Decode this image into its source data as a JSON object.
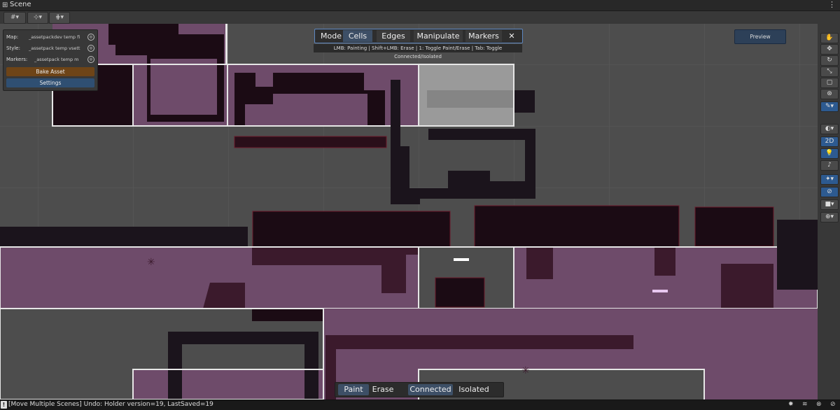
{
  "window": {
    "title": "Scene",
    "grid_icon": "grid-icon",
    "more_icon": "more-vertical-icon"
  },
  "toolbar": {
    "icons": [
      "gizmo-grid-icon",
      "snap-grid-icon",
      "increment-snap-icon"
    ]
  },
  "panel": {
    "map_label": "Map:",
    "map_value": "_assetpackdev temp fi",
    "style_label": "Style:",
    "style_value": "_assetpack temp vsett",
    "markers_label": "Markers:",
    "markers_value": "_assetpack temp m",
    "bake_button": "Bake Asset",
    "settings_button": "Settings",
    "bake_color": "#6e4417",
    "settings_color": "#2f4f72"
  },
  "modebar": {
    "mode_label": "Mode",
    "cells_tab": "Cells",
    "edges_tab": "Edges",
    "manipulate_tab": "Manipulate",
    "markers_tab": "Markers",
    "close_icon": "close-icon"
  },
  "hint": {
    "text": "LMB: Painting | Shift+LMB: Erase | 1: Toggle Paint/Erase | Tab: Toggle Connected/Isolated"
  },
  "preview": {
    "label": "Preview"
  },
  "right_tools": {
    "icons": [
      "hand-icon",
      "move-icon",
      "rotate-icon",
      "scale-icon",
      "rect-icon",
      "transform-icon",
      "brush-icon",
      "shading-icon",
      "light-icon",
      "audio-icon",
      "effects-icon",
      "visibility-icon",
      "camera-icon",
      "gizmo-icon"
    ],
    "twod_label": "2D"
  },
  "bottom": {
    "paint": "Paint",
    "erase": "Erase",
    "connected": "Connected",
    "isolated": "Isolated"
  },
  "status": {
    "message": "[Move Multiple Scenes] Undo: Holder version=19, LastSaved=19",
    "icons": [
      "bug-icon",
      "layers-icon",
      "network-icon",
      "eye-off-icon"
    ]
  },
  "colors": {
    "void": "#4d4d4d",
    "pink_fill": "#6e4b6a",
    "dark_fill": "#1b0b14",
    "room_outline": "#e6e6e6",
    "accent_blue": "#5d87c0"
  }
}
